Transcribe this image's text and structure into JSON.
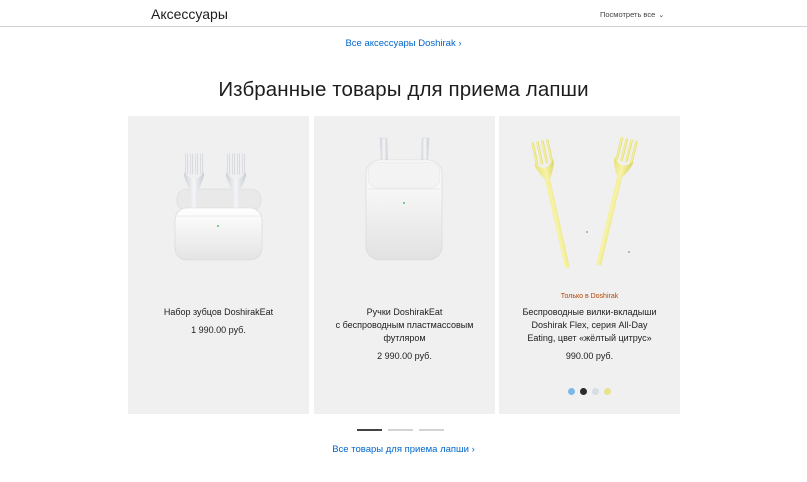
{
  "topbar": {
    "title": "Аксессуары",
    "view_all": "Посмотреть все",
    "chevron": "⌄"
  },
  "links": {
    "all_accessories": "Все аксессуары Doshirak ›",
    "all_noodle_products": "Все товары для приема лапши ›"
  },
  "section": {
    "heading": "Избранные товары для приема лапши"
  },
  "products": [
    {
      "image": "white-case-with-two-white-forks-open",
      "name": "Набор зубцов DoshirakEat",
      "price": "1 990.00 руб."
    },
    {
      "image": "white-case-with-two-white-forks-closed",
      "name": "Ручки DoshirakEat\nс беспроводным пластмассовым\nфутляром",
      "price": "2 990.00 руб."
    },
    {
      "image": "two-yellow-forks",
      "eyebrow": "Только в Doshirak",
      "name": "Беспроводные вилки-вкладыши\nDoshirak Flex, серия All-Day\nEating, цвет «жёлтый цитрус»",
      "price": "990.00 руб.",
      "swatches": [
        "#7bb8e6",
        "#2b2b2b",
        "#d6dde6",
        "#e6e38a"
      ]
    }
  ],
  "pagination": {
    "pages": 3,
    "active_index": 0
  },
  "colors": {
    "link": "#0066cc",
    "eyebrow": "#b64400",
    "card_bg": "#f0f0f0"
  }
}
